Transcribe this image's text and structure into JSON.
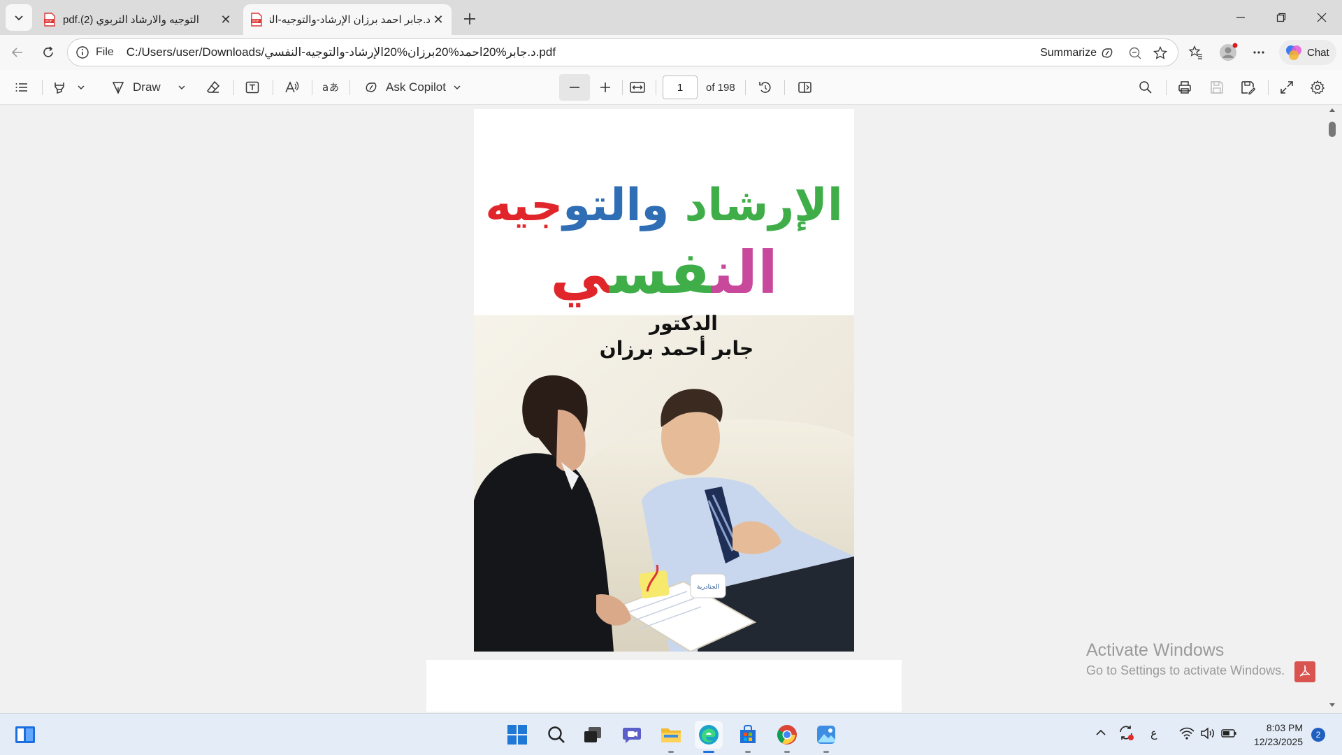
{
  "browser": {
    "tabs": [
      {
        "title": "التوجيه والارشاد التربوي (2).pdf",
        "active": false
      },
      {
        "title": "د.جابر احمد برزان الإرشاد-والتوجيه-النفسي",
        "active": true
      }
    ],
    "address": {
      "scheme_label": "File",
      "url": "C:/Users/user/Downloads/د.جابر%20احمد%20برزان%20الإرشاد-والتوجيه-النفسي.pdf"
    },
    "summarize_label": "Summarize",
    "chat_label": "Chat"
  },
  "pdf_toolbar": {
    "draw_label": "Draw",
    "ask_copilot_label": "Ask Copilot",
    "page_current": "1",
    "page_total_label": "of 198"
  },
  "document": {
    "cover_title_line1_part_green": "الإرشاد",
    "cover_title_line1_part_blue": "والتو",
    "cover_title_line1_part_red": "جيه",
    "cover_title_line2_part_pink": "الن",
    "cover_title_line2_part_green": "فس",
    "cover_title_line2_part_red": "ي",
    "author_title": "الدكتور",
    "author_name": "جابر أحمد برزان",
    "publisher_logo_text": "الجنادرية"
  },
  "watermark": {
    "line1": "Activate Windows",
    "line2": "Go to Settings to activate Windows."
  },
  "taskbar": {
    "input_lang": "ع",
    "time": "8:03 PM",
    "date": "12/23/2025",
    "notification_count": "2"
  },
  "colors": {
    "title_green": "#3fae49",
    "title_blue": "#2f6db5",
    "title_red": "#e1262b",
    "title_pink": "#c8489b"
  }
}
